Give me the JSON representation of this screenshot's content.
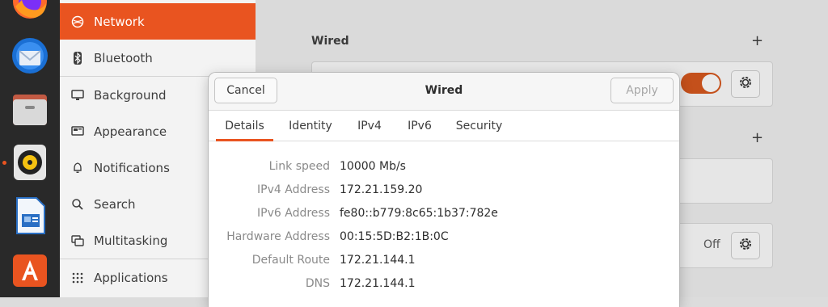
{
  "dock": {
    "items": [
      "Firefox",
      "Thunderbird Mail",
      "Files",
      "Rhythmbox",
      "LibreOffice Writer",
      "Ubuntu Software"
    ]
  },
  "sidebar": {
    "items": [
      {
        "label": "Network",
        "icon": "network-icon",
        "active": true
      },
      {
        "label": "Bluetooth",
        "icon": "bluetooth-icon"
      },
      {
        "label": "Background",
        "icon": "monitor-icon"
      },
      {
        "label": "Appearance",
        "icon": "appearance-icon"
      },
      {
        "label": "Notifications",
        "icon": "bell-icon"
      },
      {
        "label": "Search",
        "icon": "search-icon"
      },
      {
        "label": "Multitasking",
        "icon": "multitasking-icon"
      },
      {
        "label": "Applications",
        "icon": "grid-icon"
      }
    ]
  },
  "main": {
    "wired_title": "Wired",
    "add_symbol": "+",
    "off_label": "Off"
  },
  "dialog": {
    "title": "Wired",
    "cancel_label": "Cancel",
    "apply_label": "Apply",
    "tabs": [
      "Details",
      "Identity",
      "IPv4",
      "IPv6",
      "Security"
    ],
    "active_tab": "Details",
    "details": [
      {
        "key": "Link speed",
        "value": "10000 Mb/s"
      },
      {
        "key": "IPv4 Address",
        "value": "172.21.159.20"
      },
      {
        "key": "IPv6 Address",
        "value": "fe80::b779:8c65:1b37:782e"
      },
      {
        "key": "Hardware Address",
        "value": "00:15:5D:B2:1B:0C"
      },
      {
        "key": "Default Route",
        "value": "172.21.144.1"
      },
      {
        "key": "DNS",
        "value": "172.21.144.1"
      }
    ]
  },
  "colors": {
    "accent": "#e95420",
    "dock_bg": "#292929"
  }
}
